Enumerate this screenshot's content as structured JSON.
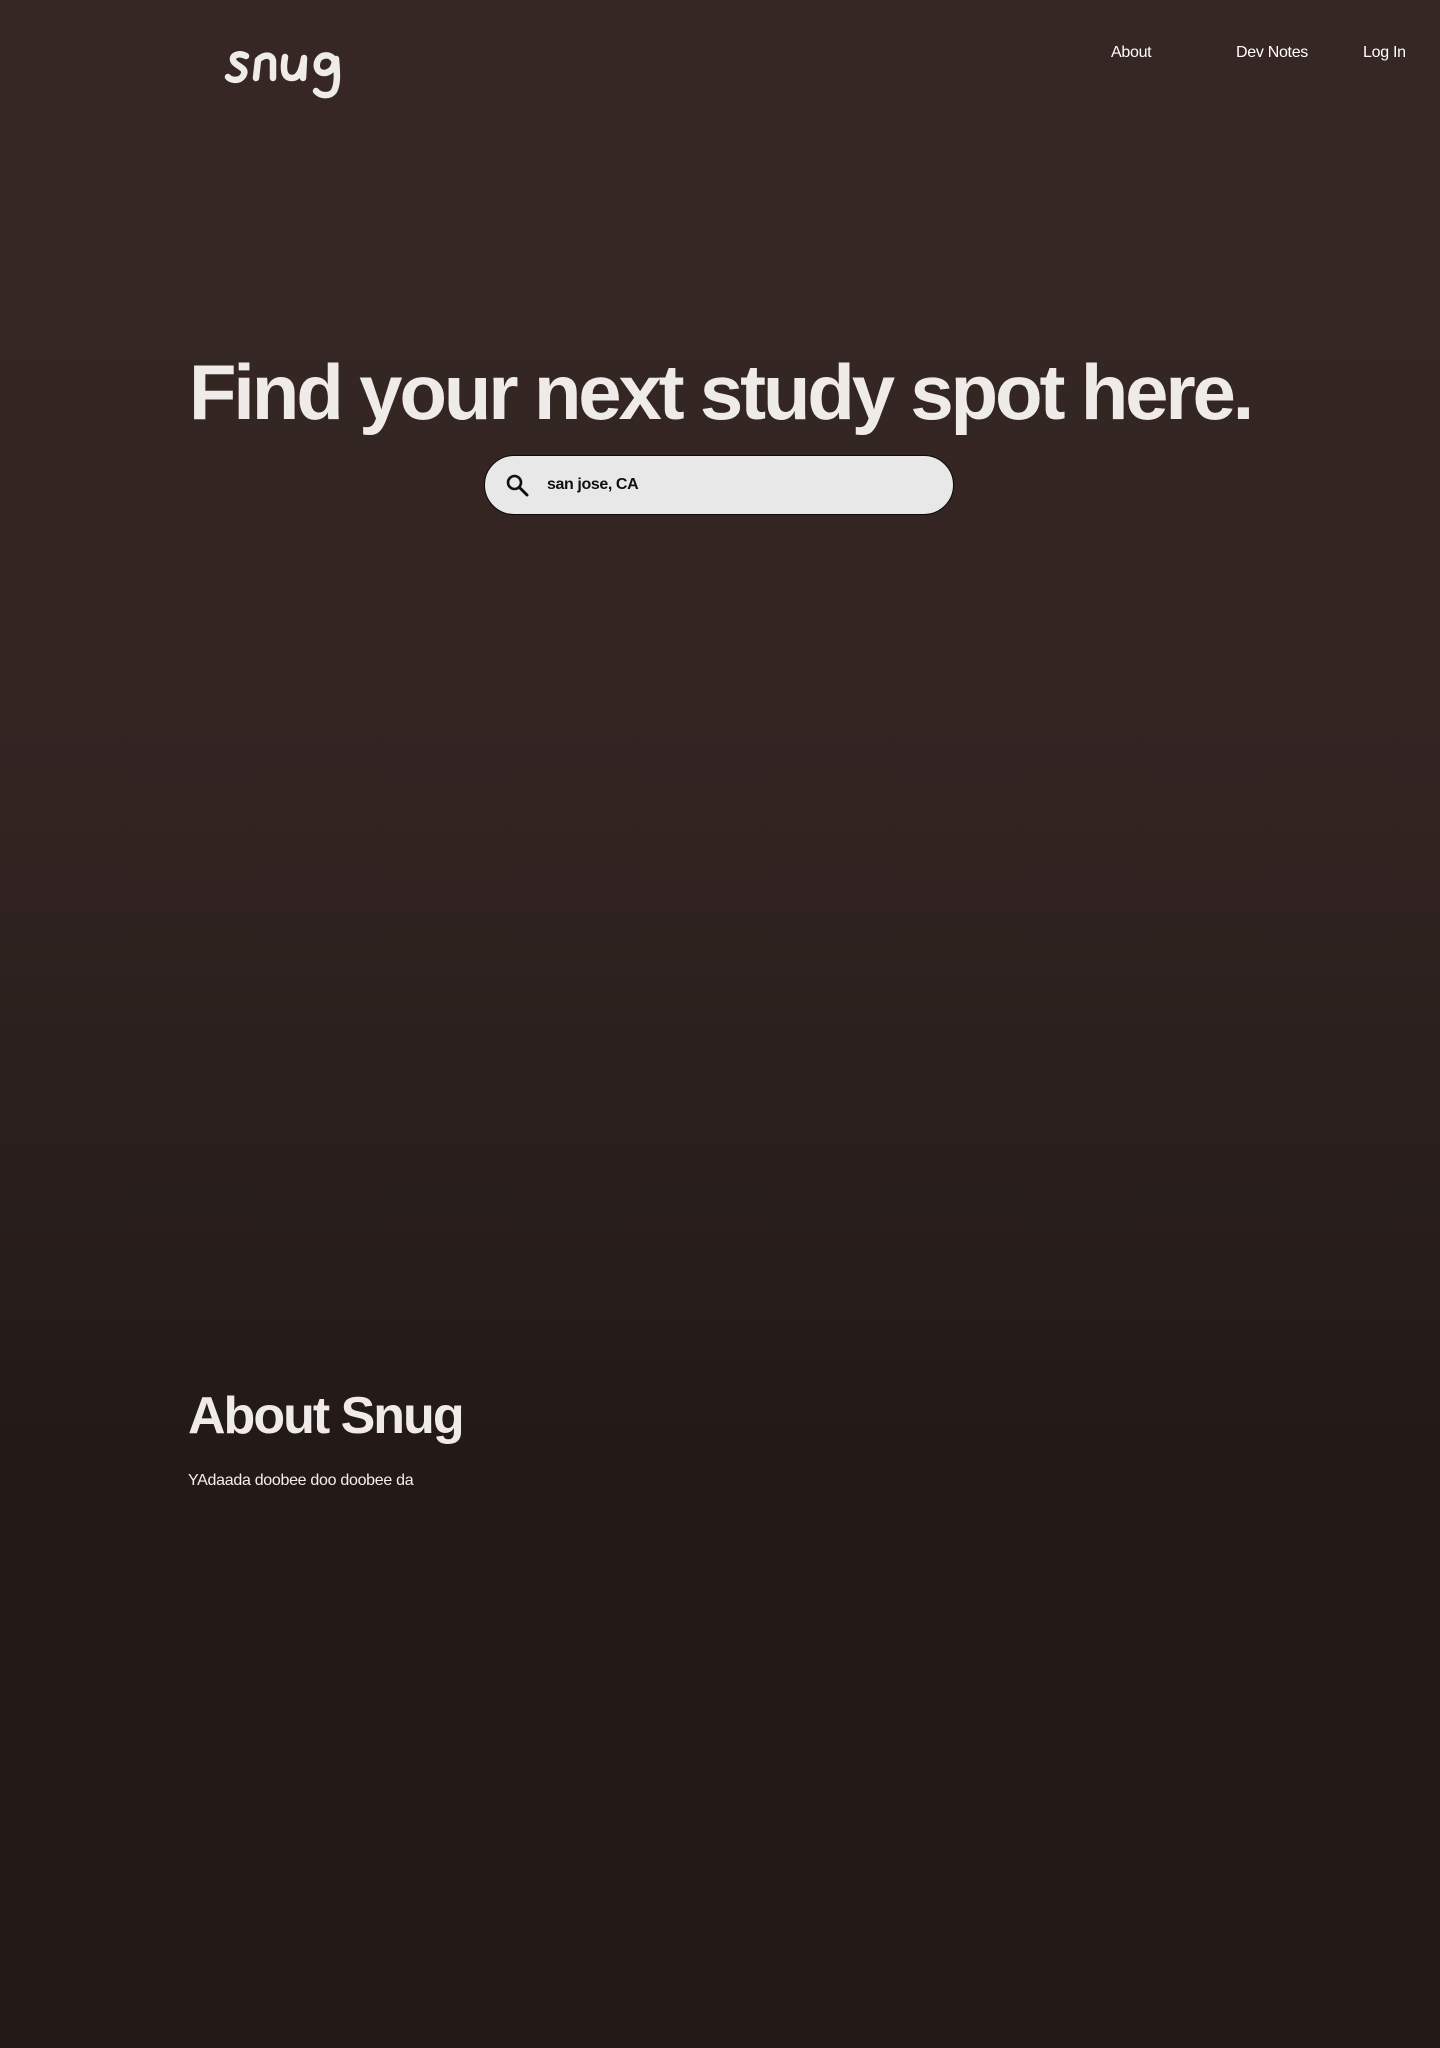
{
  "header": {
    "logo_text": "snug",
    "nav": {
      "about": "About",
      "dev_notes": "Dev Notes",
      "login": "Log In"
    }
  },
  "hero": {
    "title": "Find your next study spot here.",
    "search": {
      "value": "san jose, CA",
      "icon": "search-icon"
    }
  },
  "about": {
    "title": "About Snug",
    "body": "YAdaada doobee doo doobee da"
  },
  "colors": {
    "background_top": "#362624",
    "background_bottom": "#231917",
    "text": "#efebe8",
    "search_fill": "#e8e8e8",
    "search_border": "#0d0a0a"
  }
}
